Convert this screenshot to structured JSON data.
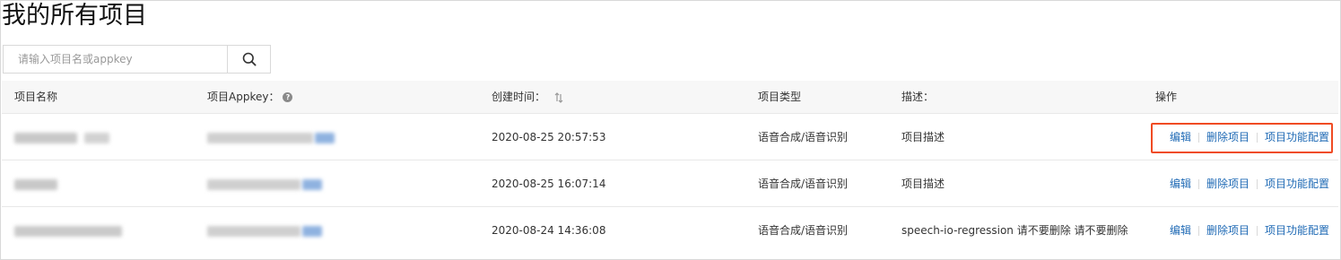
{
  "page": {
    "title": "我的所有项目"
  },
  "search": {
    "placeholder": "请输入项目名或appkey",
    "icon": "search-icon"
  },
  "table": {
    "columns": {
      "name": "项目名称",
      "appkey": "项目Appkey：",
      "created": "创建时间：",
      "type": "项目类型",
      "description": "描述：",
      "actions": "操作"
    },
    "rows": [
      {
        "created": "2020-08-25 20:57:53",
        "type": "语音合成/语音识别",
        "description": "项目描述"
      },
      {
        "created": "2020-08-25 16:07:14",
        "type": "语音合成/语音识别",
        "description": "项目描述"
      },
      {
        "created": "2020-08-24 14:36:08",
        "type": "语音合成/语音识别",
        "description": "speech-io-regression 请不要删除 请不要删除"
      }
    ],
    "action_labels": {
      "edit": "编辑",
      "delete": "删除项目",
      "config": "项目功能配置"
    }
  },
  "colors": {
    "link": "#1f6ab5",
    "highlight": "#f04b23",
    "header_bg": "#f7f7f7"
  }
}
